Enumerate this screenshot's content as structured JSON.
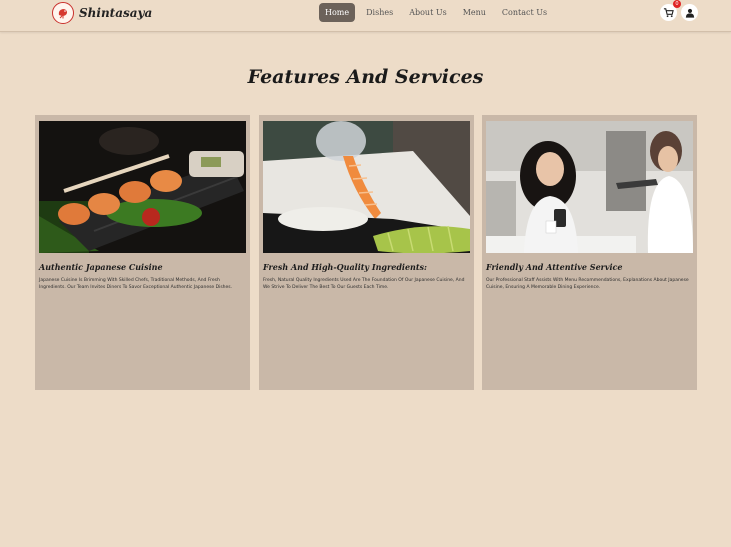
{
  "brand": {
    "name": "Shintasaya",
    "logo_icon": "shrimp-logo-icon"
  },
  "nav": {
    "links": [
      {
        "label": "Home",
        "active": true
      },
      {
        "label": "Dishes",
        "active": false
      },
      {
        "label": "About Us",
        "active": false
      },
      {
        "label": "Menu",
        "active": false
      },
      {
        "label": "Contact Us",
        "active": false
      }
    ],
    "cart_icon": "cart-icon",
    "cart_badge": "0",
    "user_icon": "user-icon"
  },
  "section": {
    "title": "Features And Services"
  },
  "cards": [
    {
      "title": "Authentic Japanese Cuisine",
      "description": "Japanese Cuisine Is Brimming With Skilled Chefs, Traditional Methods, And Fresh Ingredients. Our Team Invites Diners To Savor Exceptional Authentic Japanese Dishes."
    },
    {
      "title": "Fresh And High-Quality Ingredients:",
      "description": "Fresh, Natural Quality Ingredients Used Are The Foundation Of Our Japanese Cuisine, And We Strive To Deliver The Best To Our Guests Each Time."
    },
    {
      "title": "Friendly And Attentive Service",
      "description": "Our Professional Staff Assists With Menu Recommendations, Explanations About Japanese Cuisine, Ensuring A Memorable Dining Experience."
    }
  ],
  "colors": {
    "background": "#eddcc8",
    "card": "#c9b8a8",
    "active_nav": "#6c625a",
    "badge": "#e02424"
  }
}
